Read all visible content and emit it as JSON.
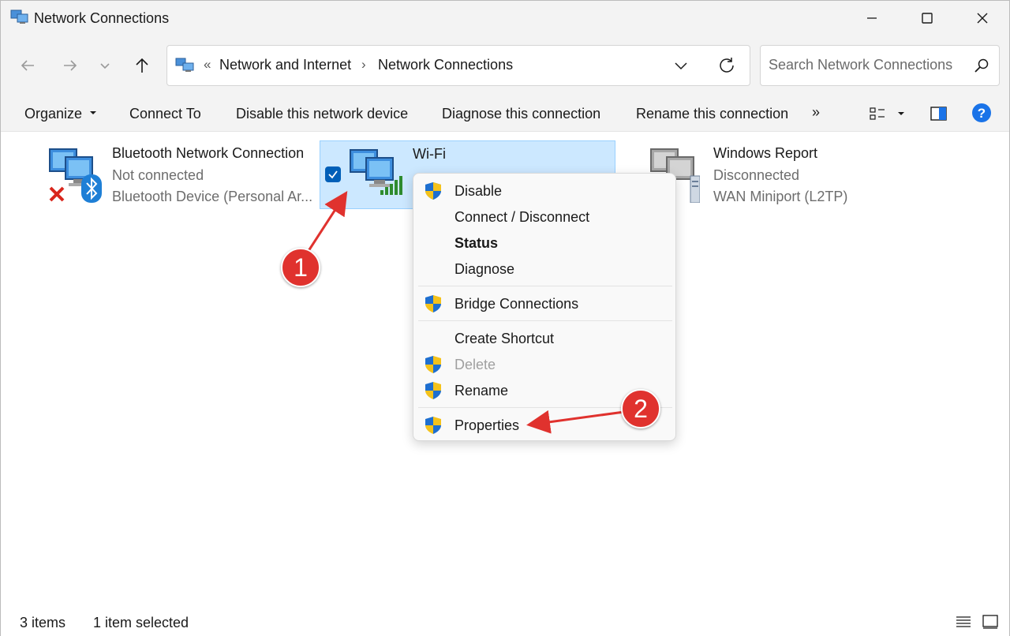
{
  "window": {
    "title": "Network Connections"
  },
  "address": {
    "overflow": "«",
    "crumbs": [
      "Network and Internet",
      "Network Connections"
    ],
    "separator": "›"
  },
  "search": {
    "placeholder": "Search Network Connections"
  },
  "toolbar": {
    "organize": "Organize",
    "connect_to": "Connect To",
    "disable": "Disable this network device",
    "diagnose": "Diagnose this connection",
    "rename": "Rename this connection",
    "more": "»"
  },
  "connections": [
    {
      "name": "Bluetooth Network Connection",
      "status": "Not connected",
      "device": "Bluetooth Device (Personal Ar..."
    },
    {
      "name": "Wi-Fi",
      "status": "",
      "device": ""
    },
    {
      "name": "Windows Report",
      "status": "Disconnected",
      "device": "WAN Miniport (L2TP)"
    }
  ],
  "context_menu": {
    "items": [
      {
        "label": "Disable",
        "shield": true
      },
      {
        "label": "Connect / Disconnect",
        "shield": false
      },
      {
        "label": "Status",
        "shield": false,
        "bold": true
      },
      {
        "label": "Diagnose",
        "shield": false
      },
      {
        "label": "Bridge Connections",
        "shield": true
      },
      {
        "label": "Create Shortcut",
        "shield": false
      },
      {
        "label": "Delete",
        "shield": true,
        "disabled": true
      },
      {
        "label": "Rename",
        "shield": true
      },
      {
        "label": "Properties",
        "shield": true
      }
    ]
  },
  "annotations": {
    "step1": "1",
    "step2": "2"
  },
  "statusbar": {
    "items": "3 items",
    "selected": "1 item selected"
  },
  "colors": {
    "selection": "#cce8ff",
    "accent": "#005fb8",
    "annotation": "#e0322e",
    "help": "#1a73e8"
  }
}
